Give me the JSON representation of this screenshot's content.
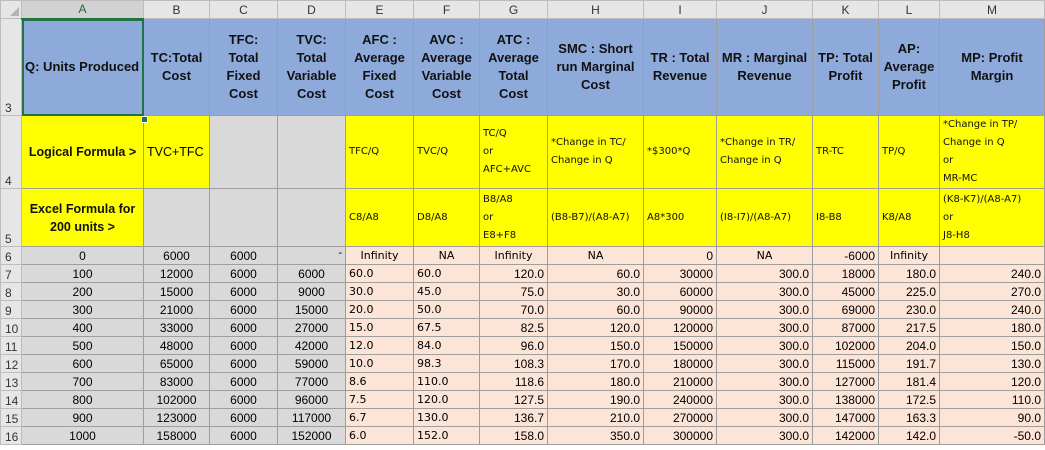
{
  "columns": [
    "A",
    "B",
    "C",
    "D",
    "E",
    "F",
    "G",
    "H",
    "I",
    "J",
    "K",
    "L",
    "M"
  ],
  "row_numbers": {
    "header": "3",
    "logical": "4",
    "excel": "5",
    "data": [
      "6",
      "7",
      "8",
      "9",
      "10",
      "11",
      "12",
      "13",
      "14",
      "15",
      "16"
    ]
  },
  "headers": [
    "Q: Units Produced",
    "TC:Total Cost",
    "TFC: Total Fixed Cost",
    "TVC: Total Variable Cost",
    "AFC : Average Fixed Cost",
    "AVC : Average Variable Cost",
    "ATC : Average Total Cost",
    "SMC : Short run Marginal Cost",
    "TR : Total Revenue",
    "MR : Marginal Revenue",
    "TP: Total Profit",
    "AP: Average Profit",
    "MP: Profit Margin"
  ],
  "logical_row": {
    "label": "Logical Formula >",
    "cells": [
      "TVC+TFC",
      "",
      "",
      "TFC/Q",
      "TVC/Q",
      "TC/Q\nor\nAFC+AVC",
      "*Change in TC/ Change in Q",
      "*$300*Q",
      "*Change in TR/ Change in Q",
      "TR-TC",
      "TP/Q",
      "*Change in TP/ Change in Q\nor\nMR-MC"
    ]
  },
  "excel_row": {
    "label": "Excel Formula for 200 units >",
    "cells": [
      "",
      "",
      "",
      "C8/A8",
      "D8/A8",
      "B8/A8\nor\nE8+F8",
      "(B8-B7)/(A8-A7)",
      "A8*300",
      "(I8-I7)/(A8-A7)",
      "I8-B8",
      "K8/A8",
      "(K8-K7)/(A8-A7)\nor\nJ8-H8"
    ]
  },
  "rows": [
    [
      "0",
      "6000",
      "6000",
      "-",
      "Infinity",
      "NA",
      "Infinity",
      "NA",
      "0",
      "NA",
      "-6000",
      "Infinity",
      ""
    ],
    [
      "100",
      "12000",
      "6000",
      "6000",
      "60.0",
      "60.0",
      "120.0",
      "60.0",
      "30000",
      "300.0",
      "18000",
      "180.0",
      "240.0"
    ],
    [
      "200",
      "15000",
      "6000",
      "9000",
      "30.0",
      "45.0",
      "75.0",
      "30.0",
      "60000",
      "300.0",
      "45000",
      "225.0",
      "270.0"
    ],
    [
      "300",
      "21000",
      "6000",
      "15000",
      "20.0",
      "50.0",
      "70.0",
      "60.0",
      "90000",
      "300.0",
      "69000",
      "230.0",
      "240.0"
    ],
    [
      "400",
      "33000",
      "6000",
      "27000",
      "15.0",
      "67.5",
      "82.5",
      "120.0",
      "120000",
      "300.0",
      "87000",
      "217.5",
      "180.0"
    ],
    [
      "500",
      "48000",
      "6000",
      "42000",
      "12.0",
      "84.0",
      "96.0",
      "150.0",
      "150000",
      "300.0",
      "102000",
      "204.0",
      "150.0"
    ],
    [
      "600",
      "65000",
      "6000",
      "59000",
      "10.0",
      "98.3",
      "108.3",
      "170.0",
      "180000",
      "300.0",
      "115000",
      "191.7",
      "130.0"
    ],
    [
      "700",
      "83000",
      "6000",
      "77000",
      "8.6",
      "110.0",
      "118.6",
      "180.0",
      "210000",
      "300.0",
      "127000",
      "181.4",
      "120.0"
    ],
    [
      "800",
      "102000",
      "6000",
      "96000",
      "7.5",
      "120.0",
      "127.5",
      "190.0",
      "240000",
      "300.0",
      "138000",
      "172.5",
      "110.0"
    ],
    [
      "900",
      "123000",
      "6000",
      "117000",
      "6.7",
      "130.0",
      "136.7",
      "210.0",
      "270000",
      "300.0",
      "147000",
      "163.3",
      "90.0"
    ],
    [
      "1000",
      "158000",
      "6000",
      "152000",
      "6.0",
      "152.0",
      "158.0",
      "350.0",
      "300000",
      "300.0",
      "142000",
      "142.0",
      "-50.0"
    ]
  ],
  "colors": {
    "header_blue": "#8eaadb",
    "yellow": "#ffff00",
    "peach": "#fce4d6",
    "grey": "#d9d9d9",
    "selection_green": "#217346"
  }
}
